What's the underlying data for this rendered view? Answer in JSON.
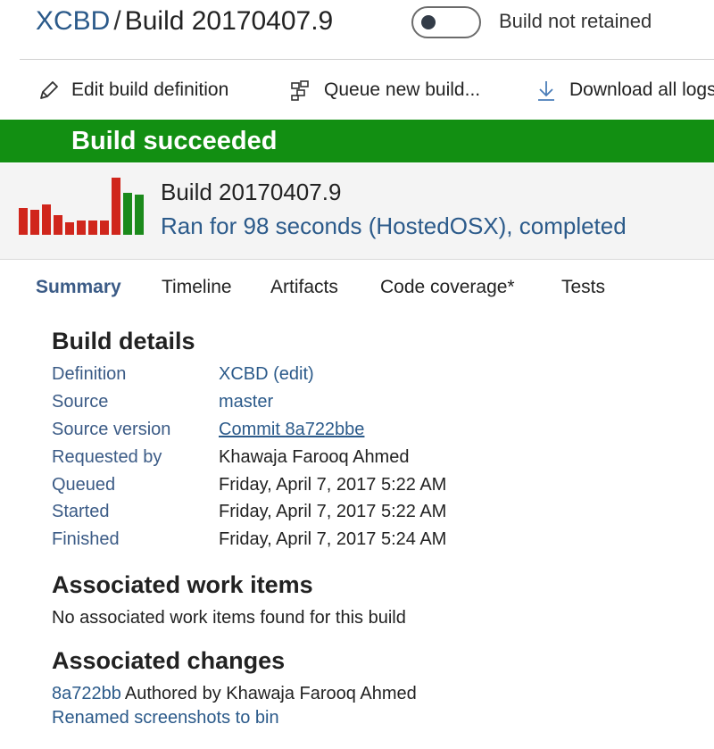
{
  "header": {
    "project": "XCBD",
    "separator": "/",
    "build_title": "Build 20170407.9",
    "retain_label": "Build not retained"
  },
  "toolbar": {
    "edit_label": "Edit build definition",
    "queue_label": "Queue new build...",
    "download_label": "Download all logs"
  },
  "banner": {
    "text": "Build succeeded",
    "color": "#128f12"
  },
  "build_summary": {
    "name": "Build 20170407.9",
    "status": "Ran for 98 seconds (HostedOSX), completed",
    "history": [
      {
        "status": "failed",
        "level": 0.47
      },
      {
        "status": "failed",
        "level": 0.44
      },
      {
        "status": "failed",
        "level": 0.53
      },
      {
        "status": "failed",
        "level": 0.34
      },
      {
        "status": "failed",
        "level": 0.22
      },
      {
        "status": "failed",
        "level": 0.25
      },
      {
        "status": "failed",
        "level": 0.25
      },
      {
        "status": "failed",
        "level": 0.25
      },
      {
        "status": "failed",
        "level": 1.0
      },
      {
        "status": "succeeded",
        "level": 0.73
      },
      {
        "status": "succeeded",
        "level": 0.7
      }
    ],
    "colors": {
      "failed": "#d0261c",
      "succeeded": "#1b8a1b"
    }
  },
  "tabs": [
    {
      "label": "Summary",
      "active": true
    },
    {
      "label": "Timeline",
      "active": false
    },
    {
      "label": "Artifacts",
      "active": false
    },
    {
      "label": "Code coverage*",
      "active": false
    },
    {
      "label": "Tests",
      "active": false
    }
  ],
  "build_details": {
    "title": "Build details",
    "rows": [
      {
        "label": "Definition",
        "value": "XCBD (edit)"
      },
      {
        "label": "Source",
        "value": "master"
      },
      {
        "label": "Source version",
        "value": "Commit 8a722bbe"
      },
      {
        "label": "Requested by",
        "value": "Khawaja Farooq Ahmed"
      },
      {
        "label": "Queued",
        "value": "Friday, April 7, 2017 5:22 AM"
      },
      {
        "label": "Started",
        "value": "Friday, April 7, 2017 5:22 AM"
      },
      {
        "label": "Finished",
        "value": "Friday, April 7, 2017 5:24 AM"
      }
    ]
  },
  "work_items": {
    "title": "Associated work items",
    "empty_text": "No associated work items found for this build"
  },
  "changes": {
    "title": "Associated changes",
    "items": [
      {
        "hash": "8a722bb",
        "author_text": "Authored by Khawaja Farooq Ahmed",
        "message": "Renamed screenshots to bin"
      }
    ]
  },
  "accent_color": "#2b5a8a"
}
